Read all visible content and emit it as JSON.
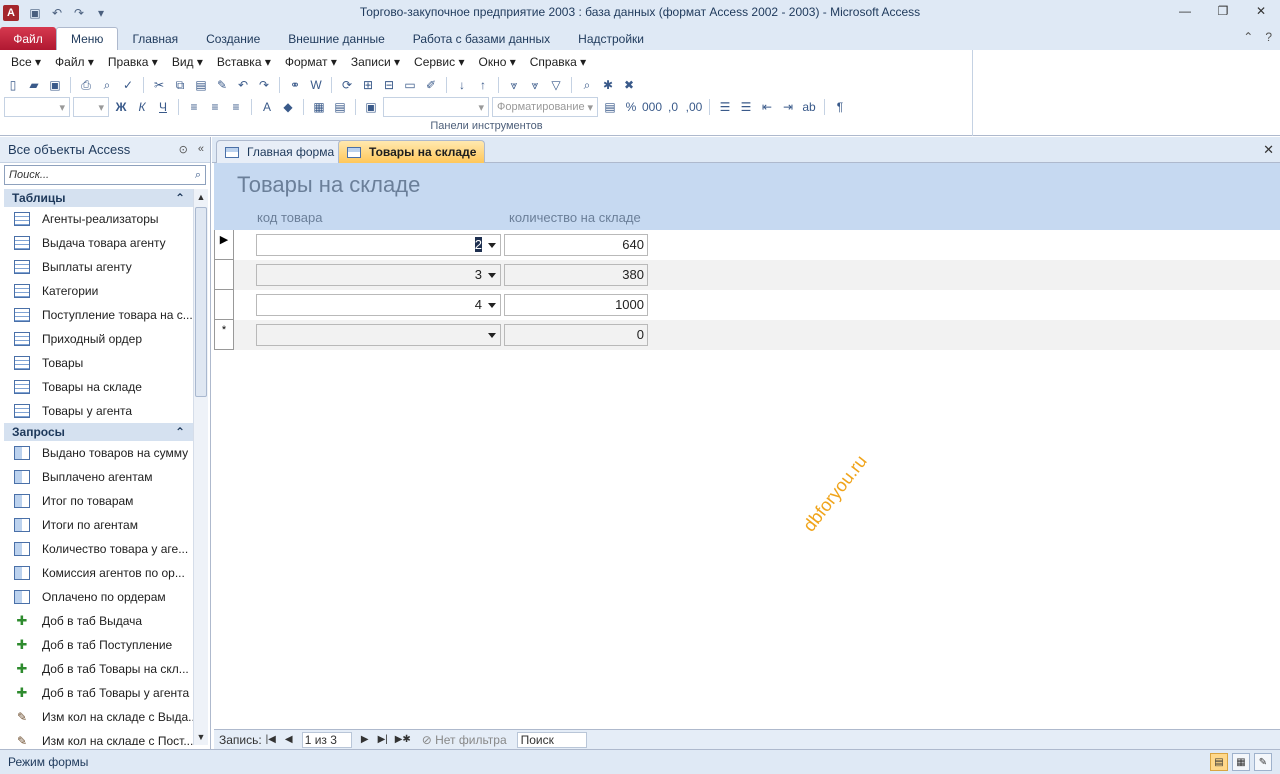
{
  "window": {
    "title": "Торгово-закупочное предприятие 2003 : база данных (формат Access 2002 - 2003)  -  Microsoft Access",
    "app_letter": "A"
  },
  "ribbon_tabs": [
    {
      "label": "Файл"
    },
    {
      "label": "Меню"
    },
    {
      "label": "Главная"
    },
    {
      "label": "Создание"
    },
    {
      "label": "Внешние данные"
    },
    {
      "label": "Работа с базами данных"
    },
    {
      "label": "Надстройки"
    }
  ],
  "menu_bar": [
    {
      "label": "Все ▾"
    },
    {
      "label": "Файл ▾"
    },
    {
      "label": "Правка ▾"
    },
    {
      "label": "Вид ▾"
    },
    {
      "label": "Вставка ▾"
    },
    {
      "label": "Формат ▾"
    },
    {
      "label": "Записи ▾"
    },
    {
      "label": "Сервис ▾"
    },
    {
      "label": "Окно ▾"
    },
    {
      "label": "Справка ▾"
    }
  ],
  "toolbar": {
    "formatting_combo": "Форматирование",
    "group_label": "Панели инструментов"
  },
  "nav": {
    "header": "Все объекты Access",
    "search_placeholder": "Поиск...",
    "tables_header": "Таблицы",
    "tables": [
      {
        "label": "Агенты-реализаторы"
      },
      {
        "label": "Выдача товара агенту"
      },
      {
        "label": "Выплаты агенту"
      },
      {
        "label": "Категории"
      },
      {
        "label": "Поступление товара на с..."
      },
      {
        "label": "Приходный ордер"
      },
      {
        "label": "Товары"
      },
      {
        "label": "Товары на складе"
      },
      {
        "label": "Товары у агента"
      }
    ],
    "queries_header": "Запросы",
    "queries": [
      {
        "label": "Выдано товаров на сумму",
        "kind": "select"
      },
      {
        "label": "Выплачено агентам",
        "kind": "select"
      },
      {
        "label": "Итог по товарам",
        "kind": "select"
      },
      {
        "label": "Итоги по агентам",
        "kind": "select"
      },
      {
        "label": "Количество товара у аге...",
        "kind": "select"
      },
      {
        "label": "Комиссия агентов по ор...",
        "kind": "select"
      },
      {
        "label": "Оплачено по ордерам",
        "kind": "select"
      },
      {
        "label": "Доб в таб Выдача",
        "kind": "append"
      },
      {
        "label": "Доб в таб Поступление",
        "kind": "append"
      },
      {
        "label": "Доб в таб Товары на скл...",
        "kind": "append"
      },
      {
        "label": "Доб в таб Товары у агента",
        "kind": "append"
      },
      {
        "label": "Изм кол на складе с Выда...",
        "kind": "update"
      },
      {
        "label": "Изм кол на складе с Пост...",
        "kind": "update"
      }
    ]
  },
  "doc_tabs": [
    {
      "label": "Главная форма"
    },
    {
      "label": "Товары на складе"
    }
  ],
  "form": {
    "title": "Товары на складе",
    "col_code": "код товара",
    "col_qty": "количество на складе",
    "rows": [
      {
        "code": "2",
        "qty": "640",
        "selector": "▶"
      },
      {
        "code": "3",
        "qty": "380",
        "selector": ""
      },
      {
        "code": "4",
        "qty": "1000",
        "selector": ""
      },
      {
        "code": "",
        "qty": "0",
        "selector": "*"
      }
    ],
    "watermark": "dbforyou.ru"
  },
  "record_nav": {
    "label": "Запись:",
    "position": "1 из 3",
    "filter": "Нет фильтра",
    "search": "Поиск"
  },
  "status": {
    "mode": "Режим формы"
  }
}
